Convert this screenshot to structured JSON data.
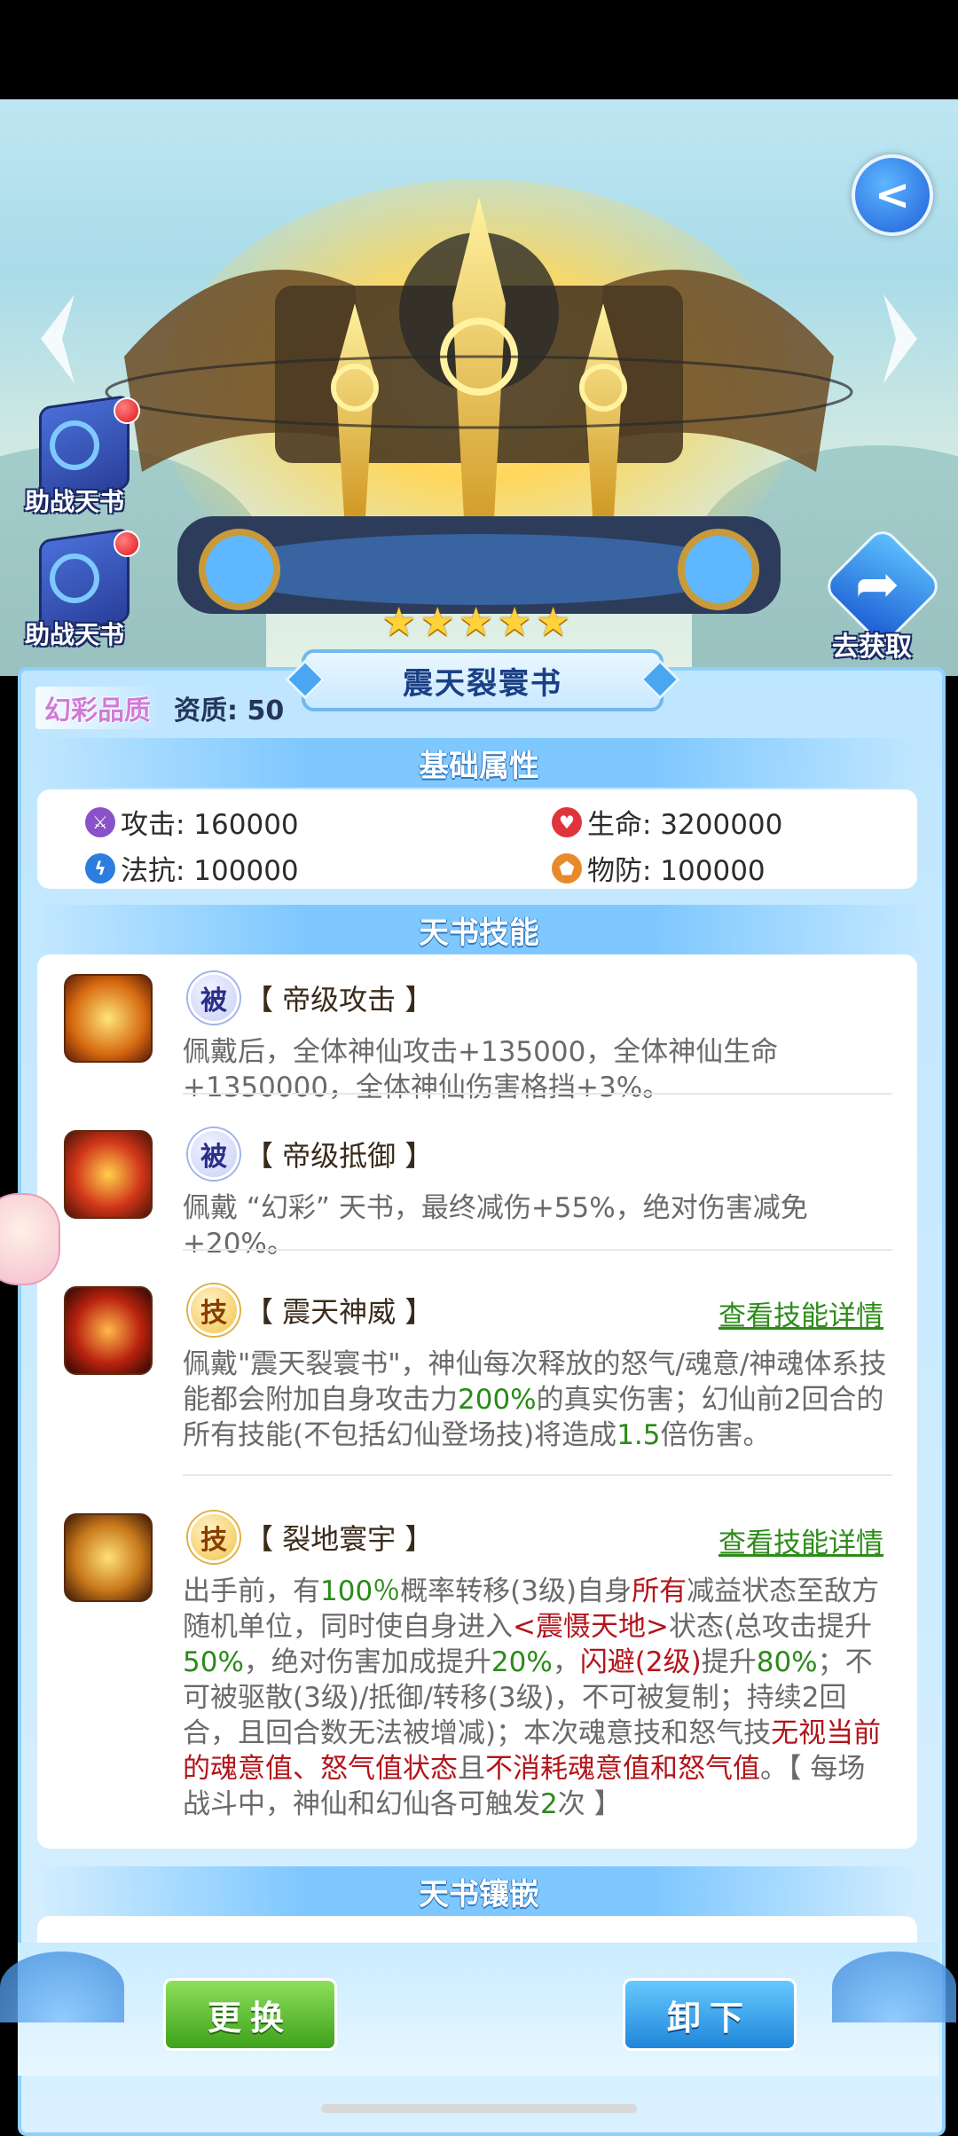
{
  "nav": {
    "back_icon": "back-arrow-icon"
  },
  "assist": [
    {
      "label": "助战天书"
    },
    {
      "label": "助战天书"
    }
  ],
  "go_get": {
    "label": "去获取"
  },
  "book": {
    "stars": 5,
    "name": "震天裂寰书",
    "quality": "幻彩品质",
    "aptitude": "资质: 50"
  },
  "sections": {
    "base": "基础属性",
    "skills": "天书技能",
    "inlay": "天书镶嵌"
  },
  "stats": {
    "attack": "攻击: 160000",
    "hp": "生命: 3200000",
    "mres": "法抗: 100000",
    "pdef": "物防: 100000"
  },
  "skills": [
    {
      "badge": "被",
      "name": "【 帝级攻击 】",
      "desc": "佩戴后，全体神仙攻击+135000，全体神仙生命+1350000，全体神仙伤害格挡+3%。"
    },
    {
      "badge": "被",
      "name": "【 帝级抵御 】",
      "desc": "佩戴 “幻彩” 天书，最终减伤+55%，绝对伤害减免+20%。"
    },
    {
      "badge": "技",
      "name": "【 震天神威 】",
      "link": "查看技能详情",
      "desc_parts": [
        {
          "t": "佩戴\"震天裂寰书\"，神仙每次释放的怒气/魂意/神魂体系技能都会附加自身攻击力",
          "c": ""
        },
        {
          "t": "200%",
          "c": "g"
        },
        {
          "t": "的真实伤害；幻仙前2回合的所有技能(不包括幻仙登场技)将造成",
          "c": ""
        },
        {
          "t": "1.5",
          "c": "g"
        },
        {
          "t": "倍伤害。",
          "c": ""
        }
      ]
    },
    {
      "badge": "技",
      "name": "【 裂地寰宇 】",
      "link": "查看技能详情",
      "desc_parts": [
        {
          "t": "出手前，有",
          "c": ""
        },
        {
          "t": "100％",
          "c": "g"
        },
        {
          "t": "概率转移(3级)自身",
          "c": ""
        },
        {
          "t": "所有",
          "c": "r"
        },
        {
          "t": "减益状态至敌方随机单位，同时使自身进入",
          "c": ""
        },
        {
          "t": "<震慑天地>",
          "c": "r"
        },
        {
          "t": "状态(总攻击提升",
          "c": ""
        },
        {
          "t": "50%",
          "c": "g"
        },
        {
          "t": "，绝对伤害加成提升",
          "c": ""
        },
        {
          "t": "20%",
          "c": "g"
        },
        {
          "t": "，",
          "c": ""
        },
        {
          "t": "闪避(2级)",
          "c": "r"
        },
        {
          "t": "提升",
          "c": ""
        },
        {
          "t": "80%",
          "c": "g"
        },
        {
          "t": "；不可被驱散(3级)/抵御/转移(3级)，不可被复制；持续2回合，且回合数无法被增减)；本次魂意技和怒气技",
          "c": ""
        },
        {
          "t": "无视当前的魂意值、怒气值状态",
          "c": "r"
        },
        {
          "t": "且",
          "c": ""
        },
        {
          "t": "不消耗魂意值和怒气值",
          "c": "r"
        },
        {
          "t": "。【 每场战斗中，神仙和幻仙各可触发",
          "c": ""
        },
        {
          "t": "2",
          "c": "g"
        },
        {
          "t": "次 】",
          "c": ""
        }
      ]
    }
  ],
  "buttons": {
    "replace": "更换",
    "unload": "卸下"
  }
}
